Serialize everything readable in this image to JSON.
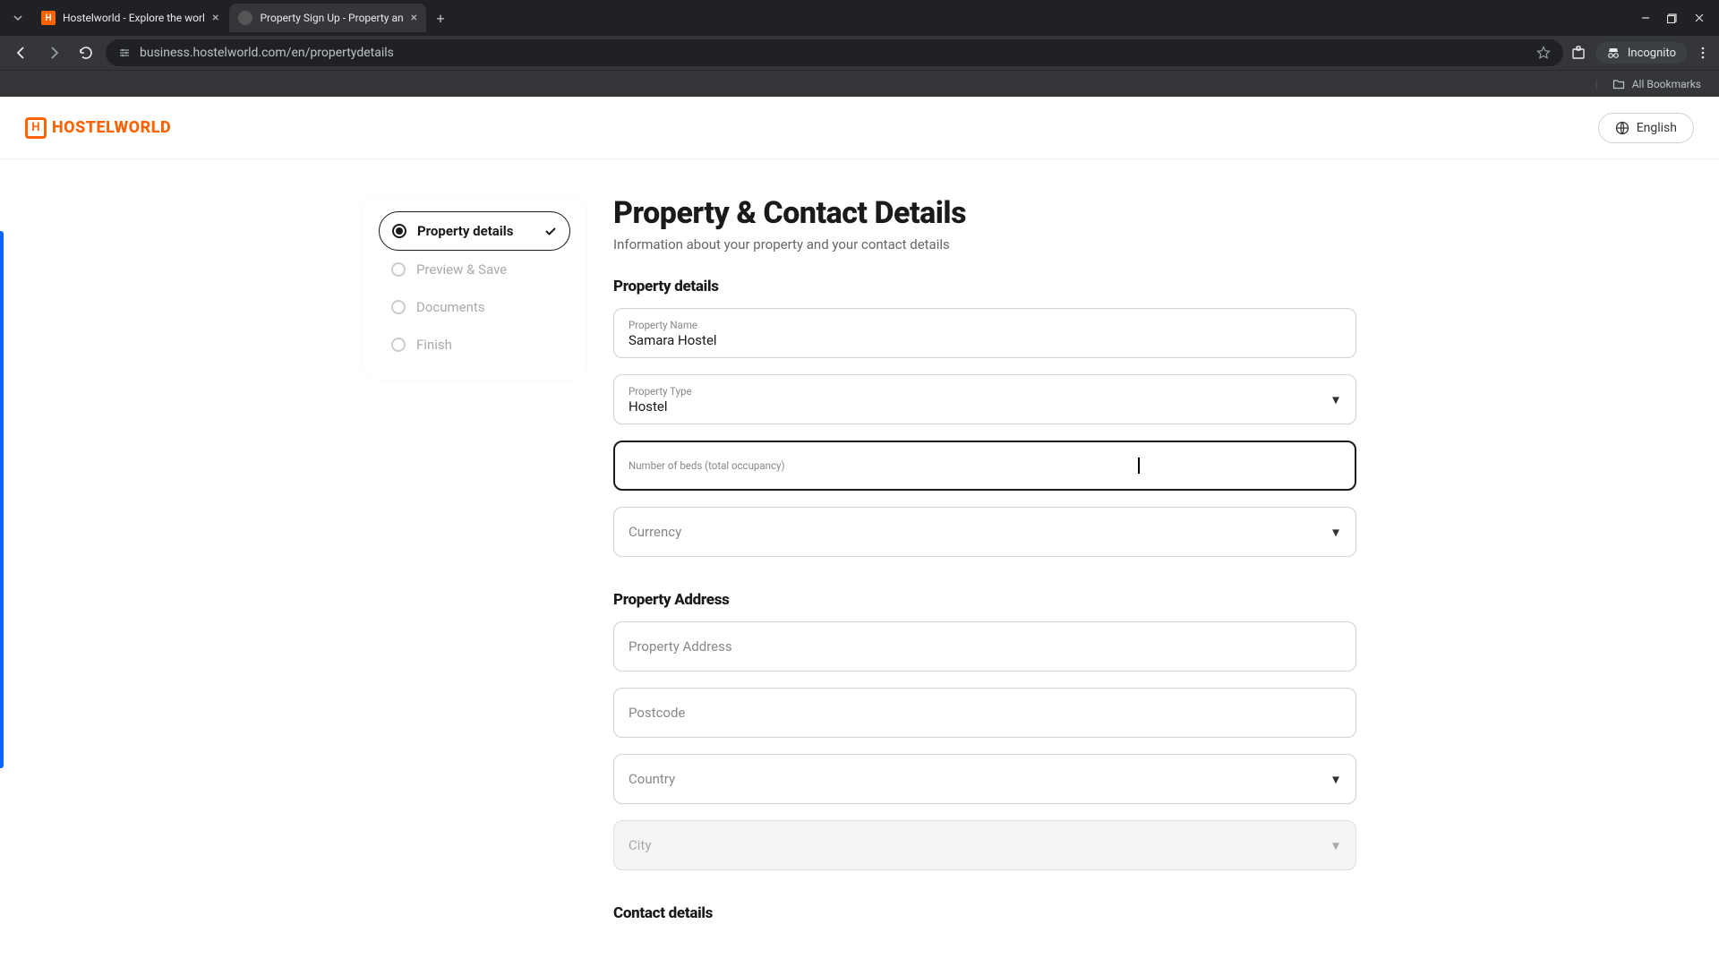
{
  "browser": {
    "tabs": [
      {
        "title": "Hostelworld - Explore the worl"
      },
      {
        "title": "Property Sign Up - Property an"
      }
    ],
    "url": "business.hostelworld.com/en/propertydetails",
    "incognito_label": "Incognito",
    "all_bookmarks": "All Bookmarks"
  },
  "header": {
    "brand": "HOSTELWORLD",
    "language": "English"
  },
  "stepper": {
    "items": [
      {
        "label": "Property details"
      },
      {
        "label": "Preview & Save"
      },
      {
        "label": "Documents"
      },
      {
        "label": "Finish"
      }
    ]
  },
  "page": {
    "title": "Property & Contact Details",
    "subtitle": "Information about your property and your contact details"
  },
  "sections": {
    "property_details_title": "Property details",
    "property_address_title": "Property Address",
    "contact_details_title": "Contact details"
  },
  "fields": {
    "property_name_label": "Property Name",
    "property_name_value": "Samara Hostel",
    "property_type_label": "Property Type",
    "property_type_value": "Hostel",
    "beds_label": "Number of beds (total occupancy)",
    "beds_value": "",
    "currency_placeholder": "Currency",
    "address_placeholder": "Property Address",
    "postcode_placeholder": "Postcode",
    "country_placeholder": "Country",
    "city_placeholder": "City"
  }
}
